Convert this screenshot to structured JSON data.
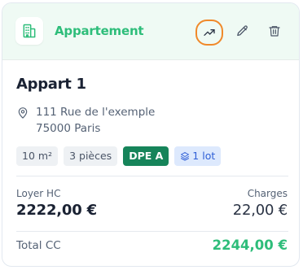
{
  "property": {
    "type_label": "Appartement",
    "title": "Appart 1",
    "address_line1": "111 Rue de l'exemple",
    "address_line2": "75000 Paris"
  },
  "tags": {
    "surface": "10 m²",
    "rooms": "3 pièces",
    "dpe": "DPE A",
    "lots": "1 lot"
  },
  "finance": {
    "rent_label": "Loyer HC",
    "rent_value": "2222,00 €",
    "charges_label": "Charges",
    "charges_value": "22,00 €",
    "total_label": "Total CC",
    "total_value": "2244,00 €"
  },
  "colors": {
    "accent_green": "#2ebd7a",
    "header_bg": "#effaf4",
    "highlight_orange": "#f0892a",
    "dpe_green": "#16845a",
    "lot_blue": "#2f5fd6"
  },
  "icons": {
    "type": "building-icon",
    "stats": "trending-up-icon",
    "edit": "pencil-icon",
    "delete": "trash-icon",
    "location": "map-pin-icon",
    "lots": "layers-icon"
  }
}
